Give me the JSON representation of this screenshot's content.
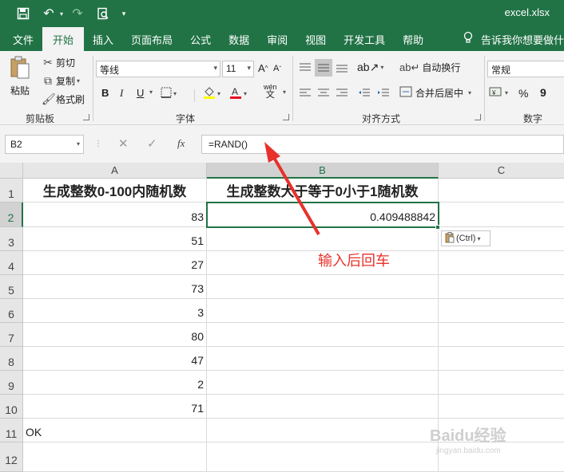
{
  "window": {
    "filename": "excel.xlsx"
  },
  "tabs": [
    "文件",
    "开始",
    "插入",
    "页面布局",
    "公式",
    "数据",
    "审阅",
    "视图",
    "开发工具",
    "帮助"
  ],
  "tell_me": "告诉我你想要做什么",
  "ribbon": {
    "clipboard": {
      "paste": "粘贴",
      "cut": "剪切",
      "copy": "复制",
      "format_painter": "格式刷",
      "label": "剪贴板"
    },
    "font": {
      "name": "等线",
      "size": "11",
      "label": "字体",
      "bold": "B",
      "italic": "I",
      "underline": "U",
      "phonetic": "wén"
    },
    "alignment": {
      "wrap": "自动换行",
      "merge": "合并后居中",
      "label": "对齐方式"
    },
    "number": {
      "format": "常规",
      "label": "数字",
      "percent": "%",
      "comma": "9"
    }
  },
  "formula_bar": {
    "name_box": "B2",
    "formula": "=RAND()",
    "fx": "fx"
  },
  "columns": [
    "A",
    "B",
    "C"
  ],
  "rows": [
    "1",
    "2",
    "3",
    "4",
    "5",
    "6",
    "7",
    "8",
    "9",
    "10",
    "11",
    "12"
  ],
  "cells": {
    "A1": "生成整数0-100内随机数",
    "B1": "生成整数大于等于0小于1随机数",
    "A": [
      "83",
      "51",
      "27",
      "73",
      "3",
      "80",
      "47",
      "2",
      "71"
    ],
    "B2": "0.409488842",
    "A11": "OK"
  },
  "paste_options": "(Ctrl)",
  "annotation": "输入后回车",
  "watermark": {
    "brand": "Baidu经验",
    "url": "jingyan.baidu.com"
  },
  "colors": {
    "excel_green": "#217346",
    "annotation_red": "#e8312b"
  }
}
